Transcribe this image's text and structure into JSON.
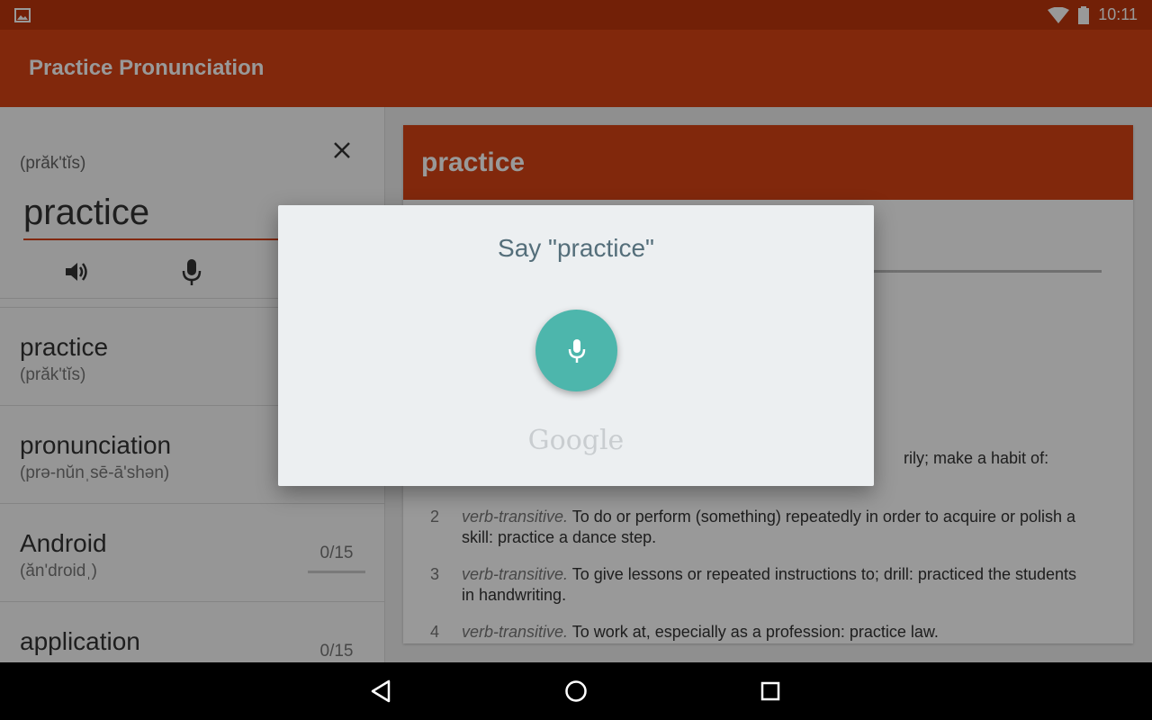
{
  "status_bar": {
    "time": "10:11",
    "icons": [
      "image-notification-icon",
      "wifi-icon",
      "battery-icon"
    ]
  },
  "app_bar": {
    "title": "Practice Pronunciation"
  },
  "search": {
    "phonetic": "(prăk'tĭs)",
    "word": "practice",
    "buttons": [
      "close-icon",
      "speaker-icon",
      "mic-icon"
    ]
  },
  "word_list": [
    {
      "word": "practice",
      "phonetic": "(prăk'tĭs)",
      "score": ""
    },
    {
      "word": "pronunciation",
      "phonetic": "(prə-nŭnˌsē-ā'shən)",
      "score": ""
    },
    {
      "word": "Android",
      "phonetic": "(ăn'droidˌ)",
      "score": "0/15"
    },
    {
      "word": "application",
      "phonetic": "",
      "score": "0/15"
    }
  ],
  "definition": {
    "title": "practice",
    "partial_text": "rily; make a habit of:",
    "entries": [
      {
        "num": "2",
        "pos": "verb-transitive.",
        "text": "To do or perform (something) repeatedly in order to acquire or polish a skill: practice a dance step."
      },
      {
        "num": "3",
        "pos": "verb-transitive.",
        "text": "To give lessons or repeated instructions to; drill: practiced the students in handwriting."
      },
      {
        "num": "4",
        "pos": "verb-transitive.",
        "text": "To work at, especially as a profession: practice law."
      }
    ]
  },
  "voice_dialog": {
    "prompt": "Say \"practice\"",
    "brand": "Google",
    "mic_color": "#4DB6AC"
  },
  "colors": {
    "primary": "#D84315",
    "primary_dark": "#BF360C"
  },
  "nav_bar": {
    "buttons": [
      "back-icon",
      "home-icon",
      "recents-icon"
    ]
  }
}
